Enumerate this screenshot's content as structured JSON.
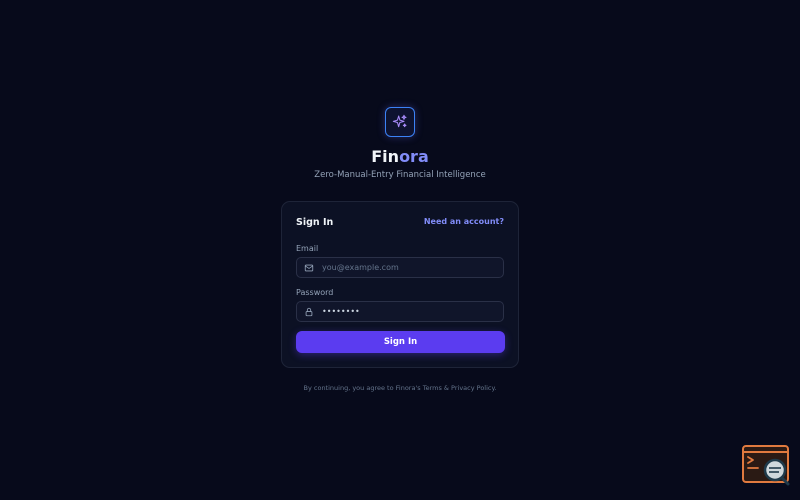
{
  "brand": {
    "name_part1": "Fin",
    "name_part2": "ora",
    "tagline": "Zero-Manual-Entry Financial Intelligence",
    "logo_icon": "sparkles-icon"
  },
  "card": {
    "title": "Sign In",
    "need_account_link": "Need an account?",
    "email": {
      "label": "Email",
      "placeholder": "you@example.com",
      "value": "",
      "icon": "mail-icon"
    },
    "password": {
      "label": "Password",
      "placeholder": "",
      "value": "••••••••",
      "icon": "lock-icon"
    },
    "submit_label": "Sign In"
  },
  "legal_text": "By continuing, you agree to Finora's Terms & Privacy Policy.",
  "colors": {
    "background": "#070a1b",
    "accent": "#818cf8",
    "button": "#5b3cf0",
    "logo_border": "#3b82f6",
    "widget": "#e07a3f"
  },
  "corner_widget": {
    "icon": "terminal-search-icon"
  }
}
